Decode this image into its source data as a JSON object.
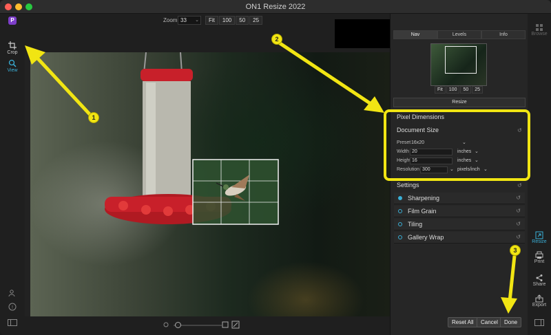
{
  "window": {
    "title": "ON1 Resize 2022"
  },
  "toolbar": {
    "zoom_label": "Zoom",
    "zoom_value": "33",
    "zoom_buttons": [
      "Fit",
      "100",
      "50",
      "25"
    ]
  },
  "left_tools": [
    {
      "label": "Crop",
      "icon": "crop-icon"
    },
    {
      "label": "View",
      "icon": "magnifier-icon"
    }
  ],
  "nav_panel": {
    "tabs": [
      "Nav",
      "Levels",
      "Info"
    ],
    "zoom_buttons": [
      "Fit",
      "100",
      "50",
      "25"
    ]
  },
  "resize_panel": {
    "header": "Resize",
    "pixel_dimensions": "Pixel Dimensions",
    "document_size": "Document Size",
    "preset_label": "Preset",
    "preset_value": "16x20",
    "width_label": "Width",
    "width_value": "20",
    "width_unit": "inches",
    "height_label": "Height",
    "height_value": "16",
    "height_unit": "inches",
    "resolution_label": "Resolution",
    "resolution_value": "300",
    "resolution_unit": "pixels/inch",
    "settings": "Settings"
  },
  "settings_items": [
    {
      "label": "Sharpening",
      "enabled": true
    },
    {
      "label": "Film Grain",
      "enabled": false
    },
    {
      "label": "Tiling",
      "enabled": false
    },
    {
      "label": "Gallery Wrap",
      "enabled": false
    }
  ],
  "bottom_buttons": {
    "reset_all": "Reset All",
    "cancel": "Cancel",
    "done": "Done"
  },
  "right_tools": [
    {
      "label": "Browse",
      "icon": "browse-icon"
    },
    {
      "label": "Resize",
      "icon": "resize-icon"
    },
    {
      "label": "Print",
      "icon": "print-icon"
    },
    {
      "label": "Share",
      "icon": "share-icon"
    },
    {
      "label": "Export",
      "icon": "export-icon"
    }
  ],
  "annotations": [
    "1",
    "2",
    "3"
  ],
  "colors": {
    "accent": "#3ab0d8",
    "highlight": "#f1e513",
    "feeder_red": "#c8202a"
  }
}
